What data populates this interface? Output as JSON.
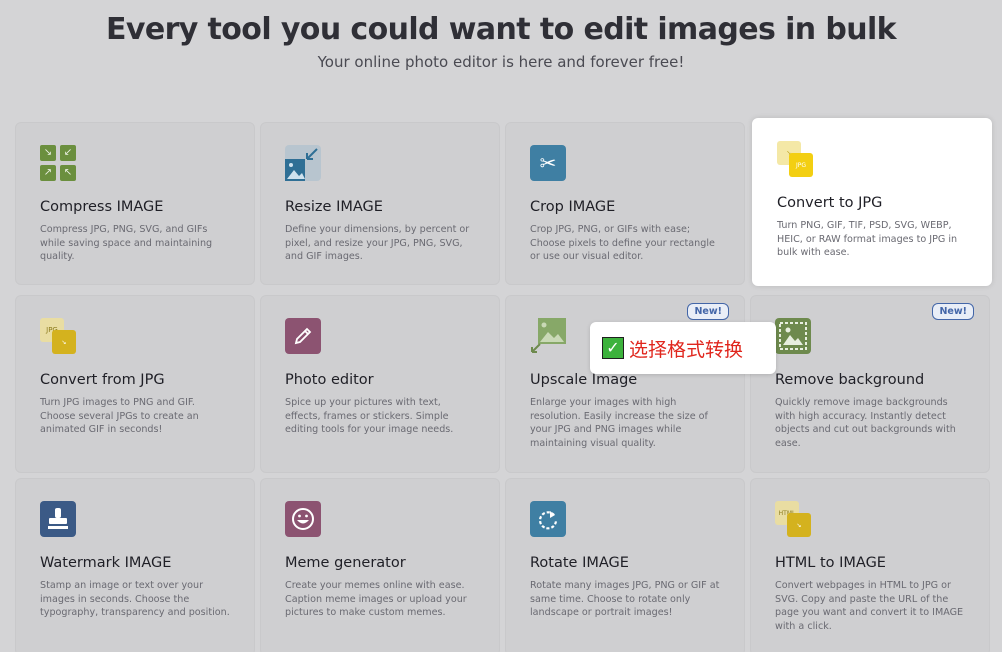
{
  "header": {
    "title": "Every tool you could want to edit images in bulk",
    "subtitle": "Your online photo editor is here and forever free!"
  },
  "tools": [
    {
      "title": "Compress IMAGE",
      "desc": "Compress JPG, PNG, SVG, and GIFs while saving space and maintaining quality.",
      "icon": "compress-icon"
    },
    {
      "title": "Resize IMAGE",
      "desc": "Define your dimensions, by percent or pixel, and resize your JPG, PNG, SVG, and GIF images.",
      "icon": "resize-icon"
    },
    {
      "title": "Crop IMAGE",
      "desc": "Crop JPG, PNG, or GIFs with ease; Choose pixels to define your rectangle or use our visual editor.",
      "icon": "scissors-icon"
    },
    {
      "title": "Convert to JPG",
      "desc": "Turn PNG, GIF, TIF, PSD, SVG, WEBP, HEIC, or RAW format images to JPG in bulk with ease.",
      "icon": "convert-to-jpg-icon",
      "icon_label": "JPG"
    },
    {
      "title": "Convert from JPG",
      "desc": "Turn JPG images to PNG and GIF. Choose several JPGs to create an animated GIF in seconds!",
      "icon": "convert-from-jpg-icon",
      "icon_label": "JPG"
    },
    {
      "title": "Photo editor",
      "desc": "Spice up your pictures with text, effects, frames or stickers. Simple editing tools for your image needs.",
      "icon": "pencil-icon"
    },
    {
      "title": "Upscale Image",
      "desc": "Enlarge your images with high resolution. Easily increase the size of your JPG and PNG images while maintaining visual quality.",
      "icon": "upscale-icon",
      "badge": "New!"
    },
    {
      "title": "Remove background",
      "desc": "Quickly remove image backgrounds with high accuracy. Instantly detect objects and cut out backgrounds with ease.",
      "icon": "remove-background-icon",
      "badge": "New!"
    },
    {
      "title": "Watermark IMAGE",
      "desc": "Stamp an image or text over your images in seconds. Choose the typography, transparency and position.",
      "icon": "stamp-icon"
    },
    {
      "title": "Meme generator",
      "desc": "Create your memes online with ease. Caption meme images or upload your pictures to make custom memes.",
      "icon": "smiley-icon"
    },
    {
      "title": "Rotate IMAGE",
      "desc": "Rotate many images JPG, PNG or GIF at same time. Choose to rotate only landscape or portrait images!",
      "icon": "rotate-icon"
    },
    {
      "title": "HTML to IMAGE",
      "desc": "Convert webpages in HTML to JPG or SVG. Copy and paste the URL of the page you want and convert it to IMAGE with a click.",
      "icon": "html-to-image-icon",
      "icon_label": "HTML"
    }
  ],
  "tooltip": {
    "text": "选择格式转换",
    "check": "✓"
  },
  "colors": {
    "badge": "#4366a8",
    "tooltip_text": "#e0261d",
    "check_bg": "#3cb23c"
  }
}
